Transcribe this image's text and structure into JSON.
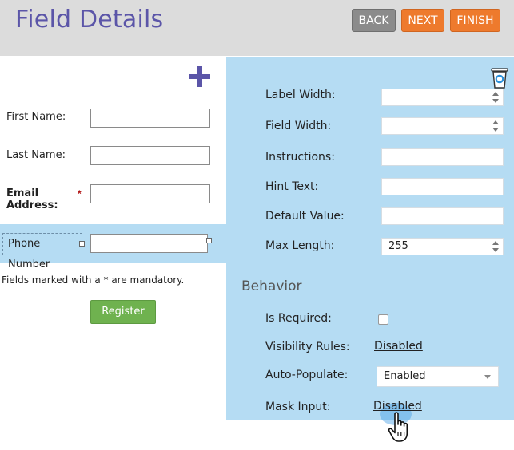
{
  "header": {
    "title": "Field Details",
    "back_label": "BACK",
    "next_label": "NEXT",
    "finish_label": "FINISH"
  },
  "form_preview": {
    "fields": [
      {
        "label": "First Name:",
        "value": ""
      },
      {
        "label": "Last Name:",
        "value": ""
      },
      {
        "label": "Email Address:",
        "value": "",
        "required_mark": "*"
      },
      {
        "label": "Phone Number",
        "value": ""
      }
    ],
    "mandatory_note": "Fields marked with a * are mandatory.",
    "register_label": "Register"
  },
  "properties": {
    "label_width": {
      "label": "Label Width:",
      "value": ""
    },
    "field_width": {
      "label": "Field Width:",
      "value": ""
    },
    "instructions": {
      "label": "Instructions:",
      "value": ""
    },
    "hint_text": {
      "label": "Hint Text:",
      "value": ""
    },
    "default_value": {
      "label": "Default Value:",
      "value": ""
    },
    "max_length": {
      "label": "Max Length:",
      "value": "255"
    }
  },
  "behavior": {
    "heading": "Behavior",
    "is_required": {
      "label": "Is Required:",
      "checked": false
    },
    "visibility_rules": {
      "label": "Visibility Rules:",
      "value": "Disabled"
    },
    "auto_populate": {
      "label": "Auto-Populate:",
      "value": "Enabled"
    },
    "mask_input": {
      "label": "Mask Input:",
      "value": "Disabled"
    }
  },
  "icons": {
    "add": "plus-icon",
    "delete": "trash-icon",
    "pointer": "hand-cursor-icon"
  },
  "colors": {
    "title": "#5b55a8",
    "back_button": "#8b8b8b",
    "accent_button": "#ee7a2d",
    "panel": "#b5dcf3",
    "register_button": "#6fb24f"
  }
}
